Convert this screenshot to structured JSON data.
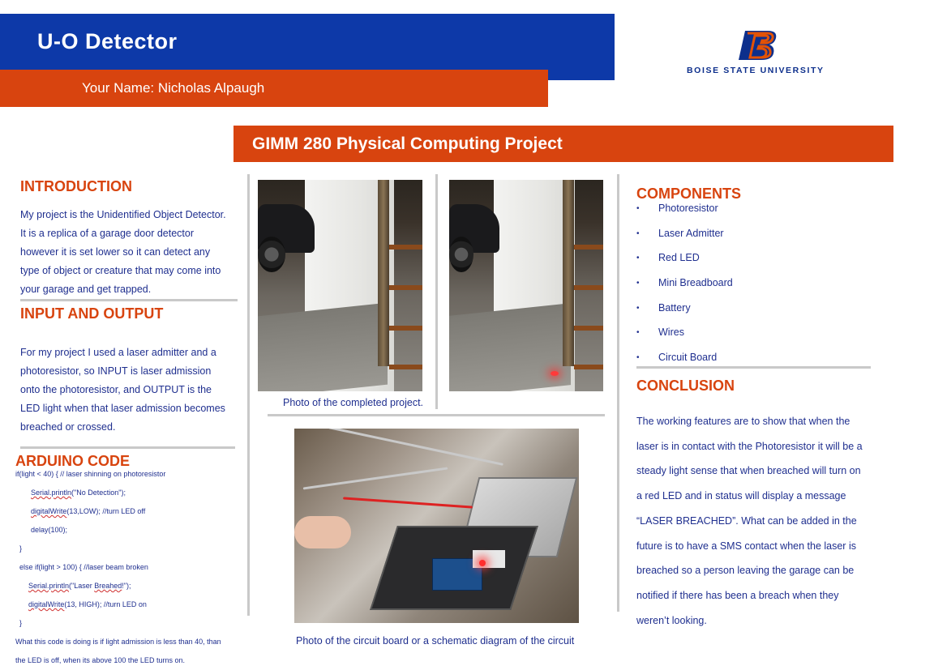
{
  "header": {
    "title": "U-O Detector",
    "name_line": "Your Name: Nicholas Alpaugh",
    "university": "BOISE STATE UNIVERSITY",
    "logo_letter": "B",
    "course": "GIMM 280 Physical Computing Project",
    "brand_blue": "#0d39a8",
    "brand_orange": "#d8440f"
  },
  "introduction": {
    "heading": "INTRODUCTION",
    "lines": [
      "My project is the Unidentified Object Detector.",
      "It is a replica of a garage door detector",
      "however it is set lower so it can detect any",
      "type of object or creature that may come into",
      "your garage and get trapped."
    ]
  },
  "io": {
    "heading": "INPUT AND OUTPUT",
    "lines": [
      "For my project I used a laser admitter and a",
      "photoresistor, so INPUT is laser admission",
      "onto the photoresistor, and OUTPUT is the",
      "LED light when that laser admission becomes",
      "breached or crossed."
    ]
  },
  "code": {
    "heading": "ARDUINO CODE",
    "l1": "if(light < 40) { // laser shinning on photoresistor",
    "l2a": "Serial.println",
    "l2b": "(\"No Detection\");",
    "l3a": "digitalWrite",
    "l3b": "(13,LOW); //turn LED off",
    "l4": "delay(100);",
    "l5": "}",
    "l6": "else if(light > 100) { //laser beam broken",
    "l7a": "Serial.println",
    "l7b": "(\"Laser ",
    "l7c": "Breahed",
    "l7d": "!\");",
    "l8a": "digitalWrite",
    "l8b": "(13, HIGH); //turn LED on",
    "l9": "}",
    "explain1": "What this code is doing is if light admission is less than 40, than",
    "explain2": "the LED is off, when its above 100 the LED turns on."
  },
  "photos": {
    "caption_top": "Photo of the completed project.",
    "caption_bottom": "Photo of the circuit board or a schematic diagram of the circuit"
  },
  "components": {
    "heading": "COMPONENTS",
    "bullet": "•",
    "items": [
      "Photoresistor",
      "Laser Admitter",
      "Red LED",
      "Mini Breadboard",
      "Battery",
      "Wires",
      "Circuit Board"
    ]
  },
  "conclusion": {
    "heading": "CONCLUSION",
    "lines": [
      "The working features are to show that when the",
      "laser is in contact with the Photoresistor it will be a",
      "steady light sense that when breached will turn on",
      "a red LED and in status will display a message",
      "“LASER BREACHED”. What can be added in the",
      "future is to have a SMS contact when the laser is",
      "breached so a person leaving the garage can be",
      "notified if there has been a breach when they",
      "weren’t looking."
    ]
  }
}
